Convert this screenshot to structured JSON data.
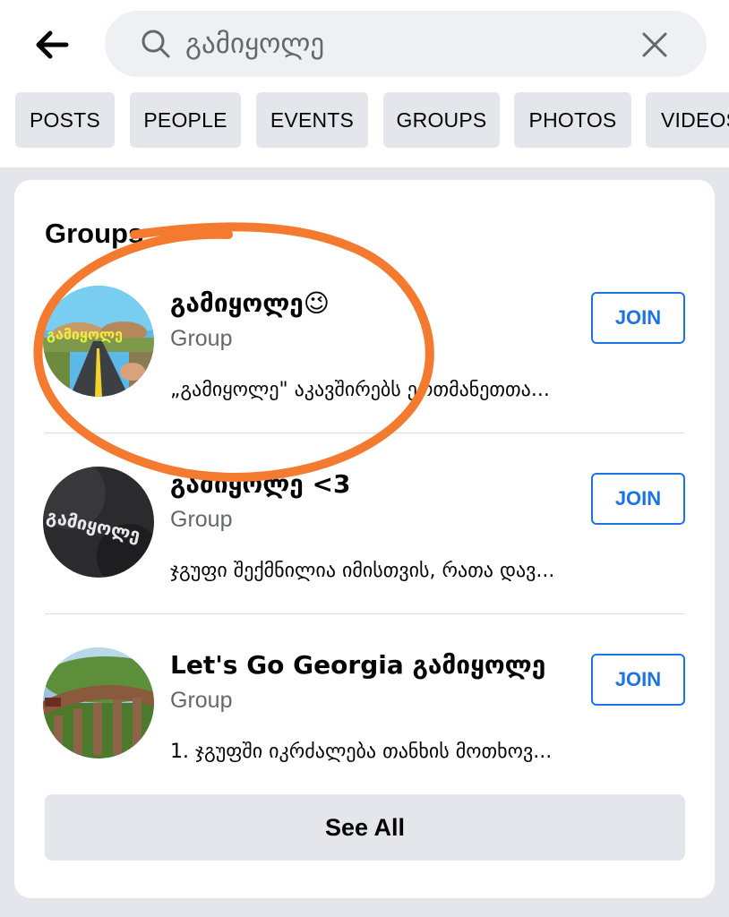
{
  "search": {
    "query": "გამიყოლე",
    "icon": "search-icon"
  },
  "filters": [
    "POSTS",
    "PEOPLE",
    "EVENTS",
    "GROUPS",
    "PHOTOS",
    "VIDEOS"
  ],
  "groups_section": {
    "title": "Groups",
    "join_label": "JOIN",
    "see_all_label": "See All",
    "accent_color": "#1b74e4",
    "items": [
      {
        "name": "გამიყოლე😉",
        "type": "Group",
        "description": "„გამიყოლე\" აკავშირებს ერთმანეთთა..."
      },
      {
        "name": "გამიყოლე <3",
        "type": "Group",
        "description": "ჯგუფი შექმნილია იმისთვის, რათა დავ..."
      },
      {
        "name": "Let's Go Georgia გამიყოლე",
        "type": "Group",
        "description": "1. ჯგუფში იკრძალება თანხის მოთხოვ..."
      }
    ]
  },
  "annotation_color": "#f47a30"
}
